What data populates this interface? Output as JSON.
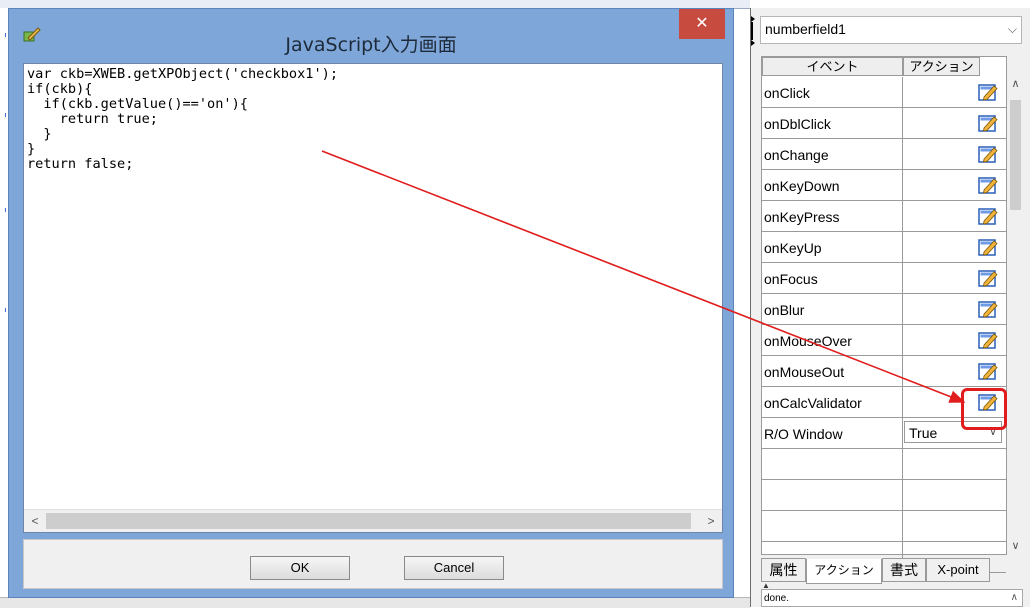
{
  "dialog": {
    "title": "JavaScript入力画面",
    "close_glyph": "✕",
    "code": "var ckb=XWEB.getXPObject('checkbox1');\nif(ckb){\n  if(ckb.getValue()=='on'){\n    return true;\n  }\n}\nreturn false;",
    "ok_label": "OK",
    "cancel_label": "Cancel",
    "scroll_left": "<",
    "scroll_right": ">"
  },
  "panel": {
    "component": "numberfield1",
    "combo_arrow": "⌵",
    "headers": {
      "event": "イベント",
      "action": "アクション"
    },
    "events": [
      "onClick",
      "onDblClick",
      "onChange",
      "onKeyDown",
      "onKeyPress",
      "onKeyUp",
      "onFocus",
      "onBlur",
      "onMouseOver",
      "onMouseOut",
      "onCalcValidator"
    ],
    "ro_window": {
      "label": "R/O Window",
      "value": "True"
    },
    "tabs": [
      "属性",
      "アクション",
      "書式",
      "X-point"
    ],
    "status": "done.",
    "icons": {
      "edit": "edit-action-icon"
    }
  },
  "colors": {
    "highlight": "#e01c1c",
    "arrow": "#e01c1c",
    "close": "#c74b3f",
    "dialog_frame": "#7fa6d8"
  }
}
